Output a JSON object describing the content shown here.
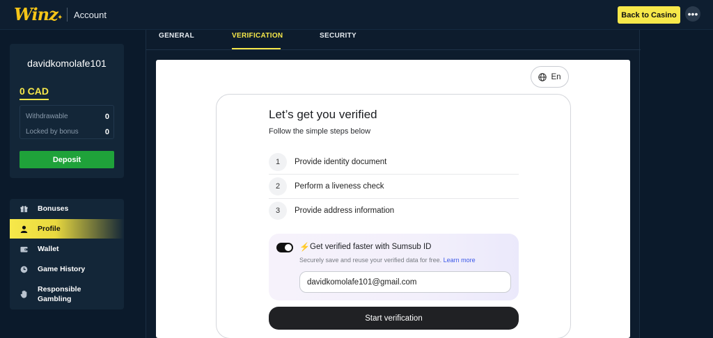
{
  "header": {
    "logo": "Winz",
    "section": "Account",
    "back_button": "Back to Casino",
    "more_icon": "ellipsis-icon"
  },
  "user": {
    "username": "davidkomolafe101",
    "balance": "0 CAD",
    "withdrawable_label": "Withdrawable",
    "withdrawable_value": "0",
    "locked_label": "Locked by bonus",
    "locked_value": "0",
    "deposit_button": "Deposit"
  },
  "sidebar": {
    "items": [
      {
        "label": "Bonuses",
        "icon": "gift-icon",
        "active": false
      },
      {
        "label": "Profile",
        "icon": "user-icon",
        "active": true
      },
      {
        "label": "Wallet",
        "icon": "wallet-icon",
        "active": false
      },
      {
        "label": "Game History",
        "icon": "clock-icon",
        "active": false
      },
      {
        "label": "Responsible Gambling",
        "icon": "hand-icon",
        "active": false
      }
    ]
  },
  "tabs": [
    {
      "label": "GENERAL",
      "active": false
    },
    {
      "label": "VERIFICATION",
      "active": true
    },
    {
      "label": "SECURITY",
      "active": false
    }
  ],
  "verification": {
    "language": "En",
    "title": "Let’s get you verified",
    "subtitle": "Follow the simple steps below",
    "steps": [
      {
        "number": "1",
        "label": "Provide identity document"
      },
      {
        "number": "2",
        "label": "Perform a liveness check"
      },
      {
        "number": "3",
        "label": "Provide address information"
      }
    ],
    "sumsub": {
      "toggle_on": true,
      "title": "Get verified faster with Sumsub ID",
      "description": "Securely save and reuse your verified data for free.",
      "link": "Learn more",
      "email": "davidkomolafe101@gmail.com"
    },
    "start_button": "Start verification"
  },
  "colors": {
    "accent_yellow": "#f7e84a",
    "deposit_green": "#1fa23a",
    "background": "#0b1a2b",
    "link_blue": "#3a57e8"
  }
}
